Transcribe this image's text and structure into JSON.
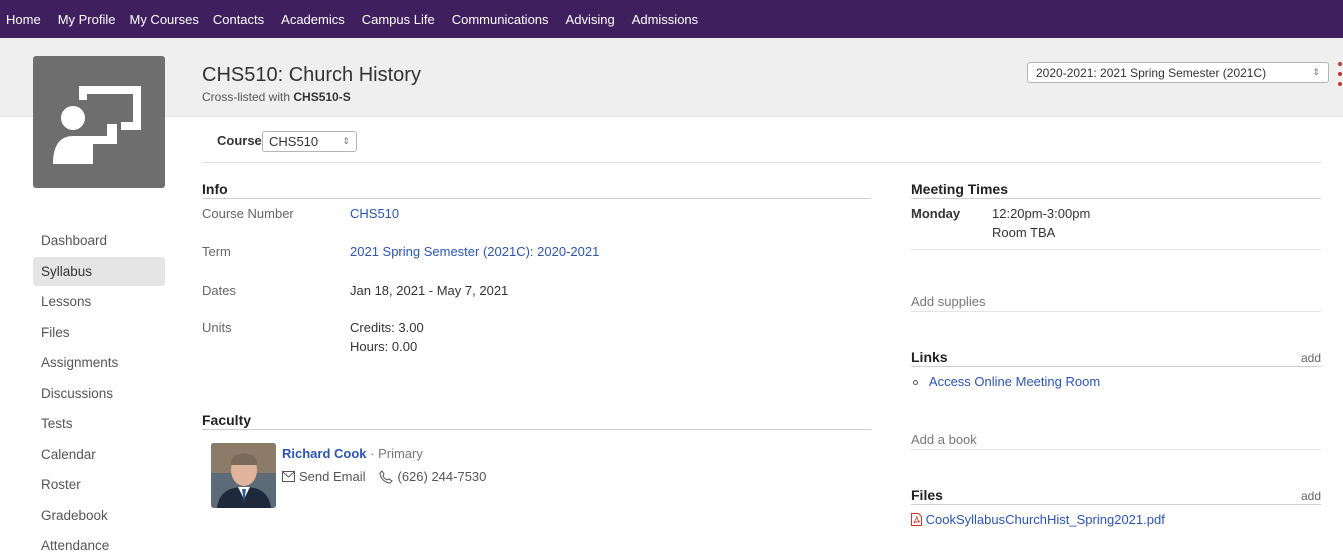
{
  "nav": [
    "Home",
    "My Profile",
    "My Courses",
    "Contacts",
    "Academics",
    "Campus Life",
    "Communications",
    "Advising",
    "Admissions"
  ],
  "header": {
    "title": "CHS510: Church History",
    "crosslisted_prefix": "Cross-listed with",
    "crosslisted_code": "CHS510-S",
    "term_select": "2020-2021: 2021 Spring Semester (2021C)"
  },
  "course_picker": {
    "label": "Course",
    "value": "CHS510"
  },
  "sidebar": [
    "Dashboard",
    "Syllabus",
    "Lessons",
    "Files",
    "Assignments",
    "Discussions",
    "Tests",
    "Calendar",
    "Roster",
    "Gradebook",
    "Attendance"
  ],
  "info": {
    "heading": "Info",
    "rows": [
      {
        "label": "Course Number",
        "value": "CHS510"
      },
      {
        "label": "Term",
        "value": "2021 Spring Semester (2021C): 2020-2021"
      },
      {
        "label": "Dates",
        "value": "Jan 18, 2021 - May 7, 2021"
      },
      {
        "label": "Units",
        "value": "Credits: 3.00",
        "value2": "Hours: 0.00"
      }
    ]
  },
  "faculty": {
    "heading": "Faculty",
    "name": "Richard Cook",
    "role": "· Primary",
    "email_label": "Send Email",
    "phone": "(626) 244-7530"
  },
  "meeting": {
    "heading": "Meeting Times",
    "day": "Monday",
    "time": "12:20pm-3:00pm",
    "room": "Room TBA"
  },
  "supplies": {
    "placeholder": "Add supplies"
  },
  "links": {
    "heading": "Links",
    "add": "add",
    "items": [
      "Access Online Meeting Room"
    ]
  },
  "books": {
    "placeholder": "Add a book"
  },
  "files": {
    "heading": "Files",
    "add": "add",
    "items": [
      "CookSyllabusChurchHist_Spring2021.pdf"
    ]
  },
  "colors": {
    "nav_bg": "#3f1f5e",
    "link": "#2b55b0",
    "pdf_icon": "#d9362b"
  }
}
